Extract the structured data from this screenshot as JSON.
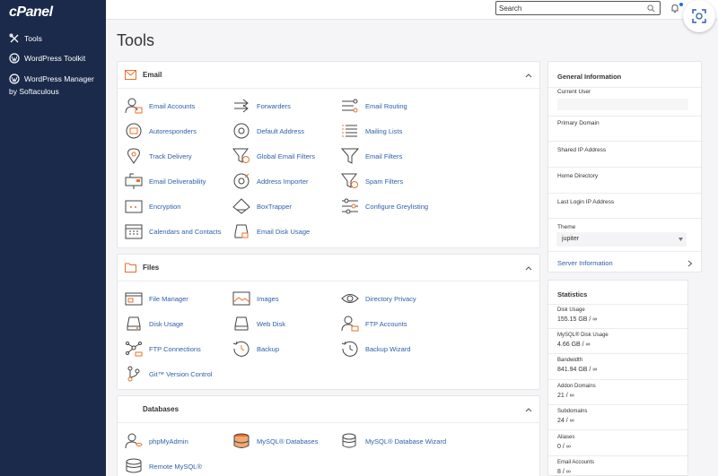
{
  "brand": {
    "logo": "cPanel"
  },
  "sidebar": {
    "items": [
      {
        "label": "Tools"
      },
      {
        "label": "WordPress Toolkit"
      },
      {
        "label": "WordPress Manager"
      }
    ],
    "wp_manager_sub": "by Softaculous"
  },
  "topbar": {
    "search_value": "Search"
  },
  "page": {
    "title": "Tools"
  },
  "sections": {
    "email": {
      "title": "Email",
      "tools": [
        "Email Accounts",
        "Forwarders",
        "Email Routing",
        "Autoresponders",
        "Default Address",
        "Mailing Lists",
        "Track Delivery",
        "Global Email Filters",
        "Email Filters",
        "Email Deliverability",
        "Address Importer",
        "Spam Filters",
        "Encryption",
        "BoxTrapper",
        "Configure Greylisting",
        "Calendars and Contacts",
        "Email Disk Usage"
      ]
    },
    "files": {
      "title": "Files",
      "tools": [
        "File Manager",
        "Images",
        "Directory Privacy",
        "Disk Usage",
        "Web Disk",
        "FTP Accounts",
        "FTP Connections",
        "Backup",
        "Backup Wizard",
        "Git™ Version Control"
      ]
    },
    "databases": {
      "title": "Databases",
      "tools": [
        "phpMyAdmin",
        "MySQL® Databases",
        "MySQL® Database Wizard",
        "Remote MySQL®"
      ]
    }
  },
  "general_info": {
    "title": "General Information",
    "current_user_label": "Current User",
    "primary_domain_label": "Primary Domain",
    "shared_ip_label": "Shared IP Address",
    "home_directory_label": "Home Directory",
    "last_login_label": "Last Login IP Address",
    "theme_label": "Theme",
    "theme_value": "jupiter",
    "server_info_link": "Server Information"
  },
  "statistics": {
    "title": "Statistics",
    "items": [
      {
        "label": "Disk Usage",
        "value": "155.15 GB / ∞"
      },
      {
        "label": "MySQL® Disk Usage",
        "value": "4.66 GB / ∞"
      },
      {
        "label": "Bandwidth",
        "value": "841.94 GB / ∞"
      },
      {
        "label": "Addon Domains",
        "value": "21 / ∞"
      },
      {
        "label": "Subdomains",
        "value": "24 / ∞"
      },
      {
        "label": "Aliases",
        "value": "0 / ∞"
      },
      {
        "label": "Email Accounts",
        "value": "8 / ∞"
      }
    ]
  },
  "colors": {
    "sidebar": "#1b2a4a",
    "link": "#2d5fa8",
    "accent": "#e8702a"
  }
}
